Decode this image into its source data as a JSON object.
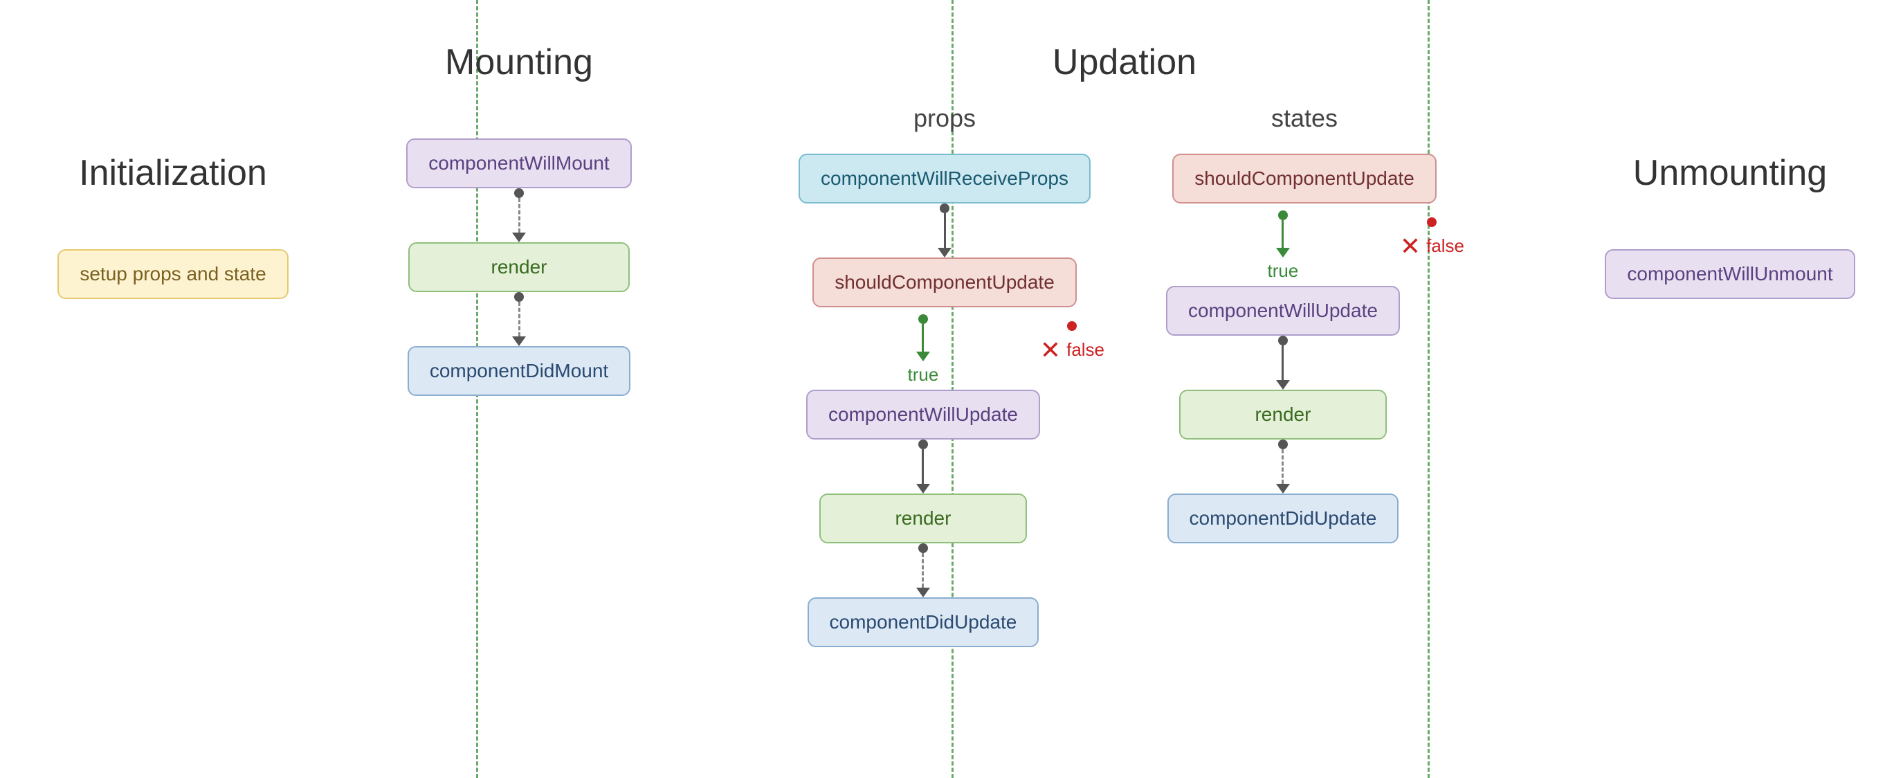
{
  "sections": {
    "initialization": {
      "title": "Initialization",
      "box": "setup props and state"
    },
    "mounting": {
      "title": "Mounting",
      "nodes": [
        {
          "id": "componentWillMount",
          "label": "componentWillMount",
          "style": "purple"
        },
        {
          "id": "render_mount",
          "label": "render",
          "style": "green"
        },
        {
          "id": "componentDidMount",
          "label": "componentDidMount",
          "style": "blue"
        }
      ]
    },
    "updation": {
      "title": "Updation",
      "props_label": "props",
      "states_label": "states",
      "props_nodes": [
        {
          "id": "componentWillReceiveProps",
          "label": "componentWillReceiveProps",
          "style": "cyan"
        },
        {
          "id": "shouldComponentUpdate_props",
          "label": "shouldComponentUpdate",
          "style": "red"
        },
        {
          "id": "componentWillUpdate_props",
          "label": "componentWillUpdate",
          "style": "purple"
        },
        {
          "id": "render_update_props",
          "label": "render",
          "style": "green"
        },
        {
          "id": "componentDidUpdate_props",
          "label": "componentDidUpdate",
          "style": "blue"
        }
      ],
      "states_nodes": [
        {
          "id": "shouldComponentUpdate_states",
          "label": "shouldComponentUpdate",
          "style": "red"
        },
        {
          "id": "componentWillUpdate_states",
          "label": "componentWillUpdate",
          "style": "purple"
        },
        {
          "id": "render_update_states",
          "label": "render",
          "style": "green"
        },
        {
          "id": "componentDidUpdate_states",
          "label": "componentDidUpdate",
          "style": "blue"
        }
      ],
      "true_label": "true",
      "false_label": "false"
    },
    "unmounting": {
      "title": "Unmounting",
      "box": "componentWillUnmount"
    }
  }
}
